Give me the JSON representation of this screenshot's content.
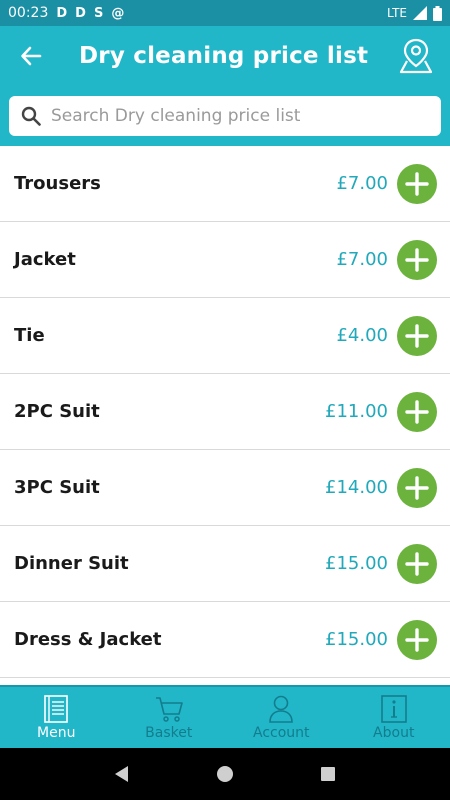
{
  "status_bar": {
    "time": "00:23",
    "notification_icons": [
      "D",
      "D",
      "S",
      "@"
    ],
    "network": "LTE"
  },
  "app_bar": {
    "title": "Dry cleaning price list",
    "back_icon": "back-arrow-icon",
    "map_icon": "map-pin-icon"
  },
  "search": {
    "placeholder": "Search Dry cleaning price list",
    "value": ""
  },
  "items": [
    {
      "name": "Trousers",
      "price": "£7.00"
    },
    {
      "name": "Jacket",
      "price": "£7.00"
    },
    {
      "name": "Tie",
      "price": "£4.00"
    },
    {
      "name": "2PC Suit",
      "price": "£11.00"
    },
    {
      "name": "3PC Suit",
      "price": "£14.00"
    },
    {
      "name": "Dinner Suit",
      "price": "£15.00"
    },
    {
      "name": "Dress & Jacket",
      "price": "£15.00"
    }
  ],
  "bottom_nav": [
    {
      "label": "Menu",
      "icon": "menu-book-icon",
      "active": true
    },
    {
      "label": "Basket",
      "icon": "basket-icon",
      "active": false
    },
    {
      "label": "Account",
      "icon": "person-icon",
      "active": false
    },
    {
      "label": "About",
      "icon": "info-icon",
      "active": false
    }
  ],
  "colors": {
    "header": "#21b7c9",
    "status_bar": "#1b8fa3",
    "price": "#21a9bb",
    "add_button": "#6cb33e"
  }
}
